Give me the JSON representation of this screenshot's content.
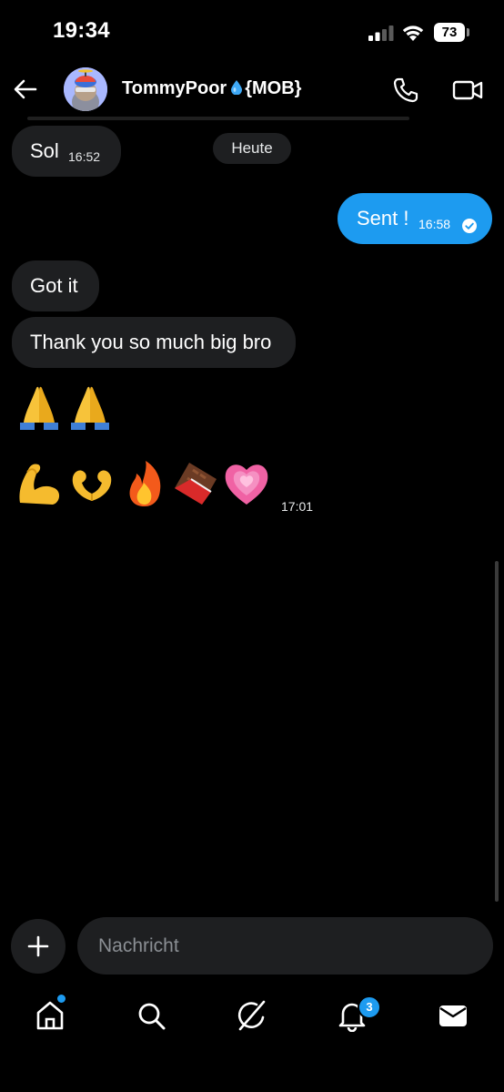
{
  "status_bar": {
    "time": "19:34",
    "battery": "73"
  },
  "header": {
    "name": "TommyPoor",
    "tag": "{MOB}"
  },
  "date_chip": "Heute",
  "messages": {
    "sol": {
      "text": "Sol",
      "time": "16:52"
    },
    "sent": {
      "text": "Sent !",
      "time": "16:58"
    },
    "got": {
      "text": "Got it"
    },
    "thanks": {
      "text": "Thank you so much big bro"
    },
    "emoji_time": "17:01"
  },
  "compose": {
    "placeholder": "Nachricht"
  },
  "nav": {
    "notifications_badge": "3"
  },
  "colors": {
    "accent": "#1d9bf0",
    "bubble_in": "#1e1f21",
    "background": "#000000"
  },
  "icons": [
    "back-arrow-icon",
    "phone-icon",
    "video-icon",
    "plus-icon",
    "home-icon",
    "search-icon",
    "grok-icon",
    "bell-icon",
    "mail-icon",
    "water-drop-icon",
    "check-circle-icon"
  ]
}
